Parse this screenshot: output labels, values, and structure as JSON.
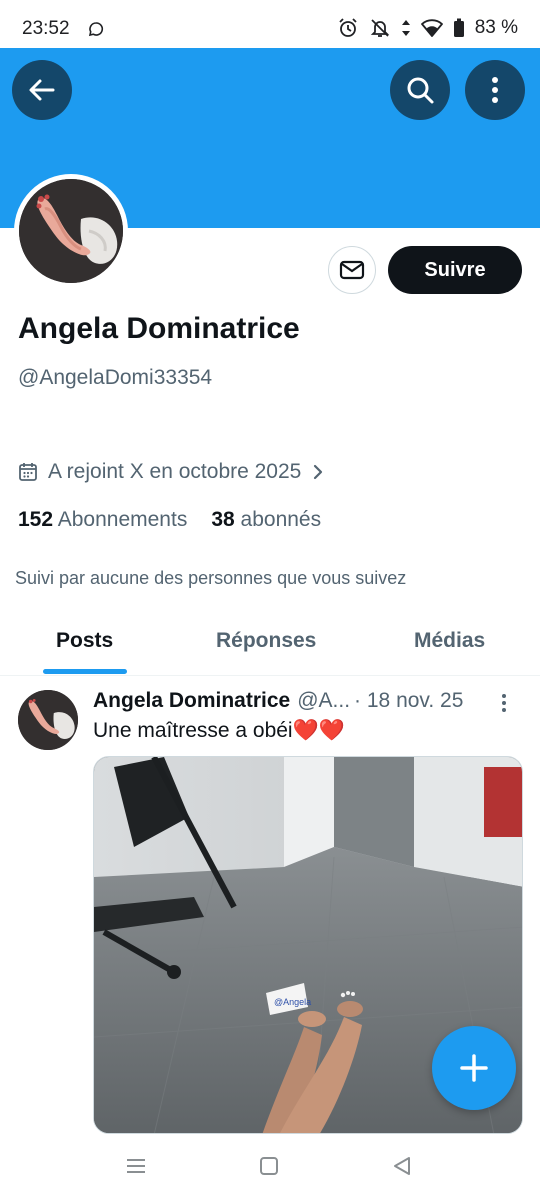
{
  "status_bar": {
    "time": "23:52",
    "battery": "83 %"
  },
  "icons": {
    "back": "arrow-left-icon",
    "search": "search-icon",
    "more": "more-vertical-icon",
    "message": "envelope-icon",
    "calendar": "calendar-icon",
    "compose": "plus-icon"
  },
  "colors": {
    "banner": "#1d9bf0",
    "accent": "#1d9bf0",
    "follow_button": "#0f1419",
    "secondary_text": "#536471",
    "heart": "#e0245e"
  },
  "profile": {
    "follow_label": "Suivre",
    "display_name": "Angela Dominatrice",
    "handle": "@AngelaDomi33354",
    "joined": "A rejoint X en octobre 2025",
    "following_count": "152",
    "following_label": "Abonnements",
    "followers_count": "38",
    "followers_label": "abonnés",
    "followed_by": "Suivi par aucune des personnes que vous suivez"
  },
  "tabs": [
    {
      "label": "Posts",
      "active": true
    },
    {
      "label": "Réponses",
      "active": false
    },
    {
      "label": "Médias",
      "active": false
    }
  ],
  "post": {
    "author": "Angela Dominatrice",
    "handle": "@A...",
    "date": "· 18 nov. 25",
    "text": "Une maîtresse a obéi❤️❤️",
    "sign_text": "@Angela"
  }
}
